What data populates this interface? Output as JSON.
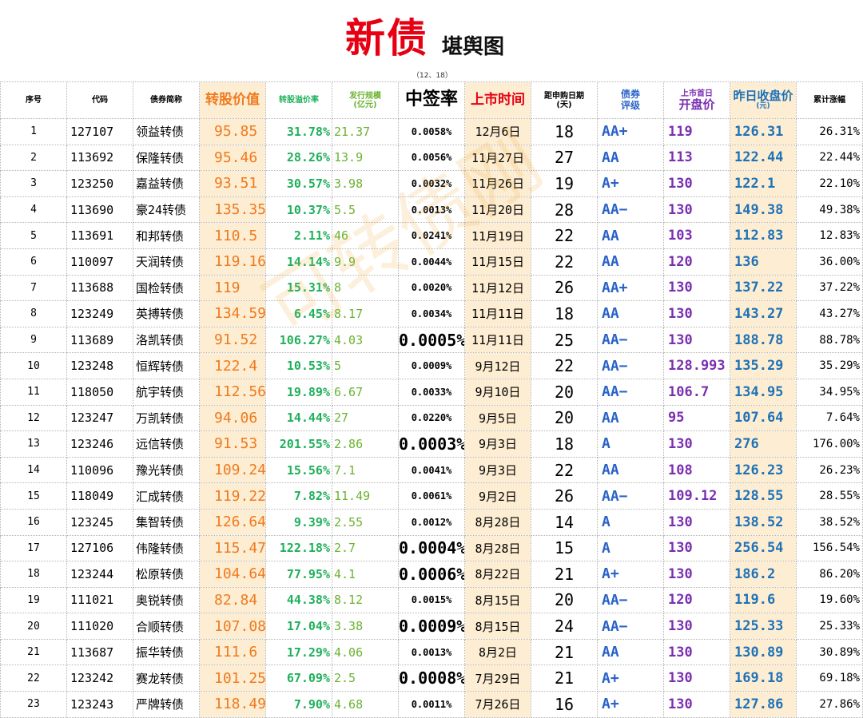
{
  "title": {
    "main": "新债",
    "sub": "堪舆图",
    "date": "（12、18）"
  },
  "headers": {
    "idx": "序号",
    "code": "代码",
    "name": "债券简称",
    "conv": "转股价值",
    "prem": "转股溢价率",
    "scale_1": "发行规模",
    "scale_2": "(亿元)",
    "rate": "中签率",
    "date": "上市时间",
    "days_1": "距申购日期",
    "days_2": "(天)",
    "rating_1": "债券",
    "rating_2": "评级",
    "open_1": "上市首日",
    "open_2": "开盘价",
    "close_1": "昨日收盘价",
    "close_2": "(元)",
    "gain": "累计涨幅"
  },
  "rows": [
    {
      "idx": "1",
      "code": "127107",
      "name": "领益转债",
      "conv": "95.85",
      "prem": "31.78%",
      "scale": "21.37",
      "rate": "0.0058%",
      "date": "12月6日",
      "days": "18",
      "rating": "AA+",
      "open": "119",
      "close": "126.31",
      "gain": "26.31%"
    },
    {
      "idx": "2",
      "code": "113692",
      "name": "保隆转债",
      "conv": "95.46",
      "prem": "28.26%",
      "scale": "13.9",
      "rate": "0.0056%",
      "date": "11月27日",
      "days": "27",
      "rating": "AA",
      "open": "113",
      "close": "122.44",
      "gain": "22.44%"
    },
    {
      "idx": "3",
      "code": "123250",
      "name": "嘉益转债",
      "conv": "93.51",
      "prem": "30.57%",
      "scale": "3.98",
      "rate": "0.0032%",
      "date": "11月26日",
      "days": "19",
      "rating": "A+",
      "open": "130",
      "close": "122.1",
      "gain": "22.10%"
    },
    {
      "idx": "4",
      "code": "113690",
      "name": "豪24转债",
      "conv": "135.35",
      "prem": "10.37%",
      "scale": "5.5",
      "rate": "0.0013%",
      "date": "11月20日",
      "days": "28",
      "rating": "AA−",
      "open": "130",
      "close": "149.38",
      "gain": "49.38%"
    },
    {
      "idx": "5",
      "code": "113691",
      "name": "和邦转债",
      "conv": "110.5",
      "prem": "2.11%",
      "scale": "46",
      "rate": "0.0241%",
      "date": "11月19日",
      "days": "22",
      "rating": "AA",
      "open": "103",
      "close": "112.83",
      "gain": "12.83%"
    },
    {
      "idx": "6",
      "code": "110097",
      "name": "天润转债",
      "conv": "119.16",
      "prem": "14.14%",
      "scale": "9.9",
      "rate": "0.0044%",
      "date": "11月15日",
      "days": "22",
      "rating": "AA",
      "open": "120",
      "close": "136",
      "gain": "36.00%"
    },
    {
      "idx": "7",
      "code": "113688",
      "name": "国检转债",
      "conv": "119",
      "prem": "15.31%",
      "scale": "8",
      "rate": "0.0020%",
      "date": "11月12日",
      "days": "26",
      "rating": "AA+",
      "open": "130",
      "close": "137.22",
      "gain": "37.22%"
    },
    {
      "idx": "8",
      "code": "123249",
      "name": "英搏转债",
      "conv": "134.59",
      "prem": "6.45%",
      "scale": "8.17",
      "rate": "0.0034%",
      "date": "11月11日",
      "days": "18",
      "rating": "AA",
      "open": "130",
      "close": "143.27",
      "gain": "43.27%"
    },
    {
      "idx": "9",
      "code": "113689",
      "name": "洛凯转债",
      "conv": "91.52",
      "prem": "106.27%",
      "scale": "4.03",
      "rate": "0.0005%",
      "rate_big": true,
      "date": "11月11日",
      "days": "25",
      "rating": "AA−",
      "open": "130",
      "close": "188.78",
      "gain": "88.78%"
    },
    {
      "idx": "10",
      "code": "123248",
      "name": "恒辉转债",
      "conv": "122.4",
      "prem": "10.53%",
      "scale": "5",
      "rate": "0.0009%",
      "date": "9月12日",
      "days": "22",
      "rating": "AA−",
      "open": "128.993",
      "close": "135.29",
      "gain": "35.29%"
    },
    {
      "idx": "11",
      "code": "118050",
      "name": "航宇转债",
      "conv": "112.56",
      "prem": "19.89%",
      "scale": "6.67",
      "rate": "0.0033%",
      "date": "9月10日",
      "days": "20",
      "rating": "AA−",
      "open": "106.7",
      "close": "134.95",
      "gain": "34.95%"
    },
    {
      "idx": "12",
      "code": "123247",
      "name": "万凯转债",
      "conv": "94.06",
      "prem": "14.44%",
      "scale": "27",
      "rate": "0.0220%",
      "date": "9月5日",
      "days": "20",
      "rating": "AA",
      "open": "95",
      "close": "107.64",
      "gain": "7.64%"
    },
    {
      "idx": "13",
      "code": "123246",
      "name": "远信转债",
      "conv": "91.53",
      "prem": "201.55%",
      "scale": "2.86",
      "rate": "0.0003%",
      "rate_big": true,
      "date": "9月3日",
      "days": "18",
      "rating": "A",
      "open": "130",
      "close": "276",
      "gain": "176.00%"
    },
    {
      "idx": "14",
      "code": "110096",
      "name": "豫光转债",
      "conv": "109.24",
      "prem": "15.56%",
      "scale": "7.1",
      "rate": "0.0041%",
      "date": "9月3日",
      "days": "22",
      "rating": "AA",
      "open": "108",
      "close": "126.23",
      "gain": "26.23%"
    },
    {
      "idx": "15",
      "code": "118049",
      "name": "汇成转债",
      "conv": "119.22",
      "prem": "7.82%",
      "scale": "11.49",
      "rate": "0.0061%",
      "date": "9月2日",
      "days": "26",
      "rating": "AA−",
      "open": "109.12",
      "close": "128.55",
      "gain": "28.55%"
    },
    {
      "idx": "16",
      "code": "123245",
      "name": "集智转债",
      "conv": "126.64",
      "prem": "9.39%",
      "scale": "2.55",
      "rate": "0.0012%",
      "date": "8月28日",
      "days": "14",
      "rating": "A",
      "open": "130",
      "close": "138.52",
      "gain": "38.52%"
    },
    {
      "idx": "17",
      "code": "127106",
      "name": "伟隆转债",
      "conv": "115.47",
      "prem": "122.18%",
      "scale": "2.7",
      "rate": "0.0004%",
      "rate_big": true,
      "date": "8月28日",
      "days": "15",
      "rating": "A",
      "open": "130",
      "close": "256.54",
      "gain": "156.54%"
    },
    {
      "idx": "18",
      "code": "123244",
      "name": "松原转债",
      "conv": "104.64",
      "prem": "77.95%",
      "scale": "4.1",
      "rate": "0.0006%",
      "rate_big": true,
      "date": "8月22日",
      "days": "21",
      "rating": "A+",
      "open": "130",
      "close": "186.2",
      "gain": "86.20%"
    },
    {
      "idx": "19",
      "code": "111021",
      "name": "奥锐转债",
      "conv": "82.84",
      "prem": "44.38%",
      "scale": "8.12",
      "rate": "0.0015%",
      "date": "8月15日",
      "days": "20",
      "rating": "AA−",
      "open": "120",
      "close": "119.6",
      "gain": "19.60%"
    },
    {
      "idx": "20",
      "code": "111020",
      "name": "合顺转债",
      "conv": "107.08",
      "prem": "17.04%",
      "scale": "3.38",
      "rate": "0.0009%",
      "rate_big": true,
      "date": "8月15日",
      "days": "24",
      "rating": "AA−",
      "open": "130",
      "close": "125.33",
      "gain": "25.33%"
    },
    {
      "idx": "21",
      "code": "113687",
      "name": "振华转债",
      "conv": "111.6",
      "prem": "17.29%",
      "scale": "4.06",
      "rate": "0.0013%",
      "date": "8月2日",
      "days": "21",
      "rating": "AA",
      "open": "130",
      "close": "130.89",
      "gain": "30.89%"
    },
    {
      "idx": "22",
      "code": "123242",
      "name": "赛龙转债",
      "conv": "101.25",
      "prem": "67.09%",
      "scale": "2.5",
      "rate": "0.0008%",
      "rate_big": true,
      "date": "7月29日",
      "days": "21",
      "rating": "A+",
      "open": "130",
      "close": "169.18",
      "gain": "69.18%"
    },
    {
      "idx": "23",
      "code": "123243",
      "name": "严牌转债",
      "conv": "118.49",
      "prem": "7.90%",
      "scale": "4.68",
      "rate": "0.0011%",
      "date": "7月26日",
      "days": "16",
      "rating": "A+",
      "open": "130",
      "close": "127.86",
      "gain": "27.86%"
    }
  ],
  "watermark": "可转债刚"
}
